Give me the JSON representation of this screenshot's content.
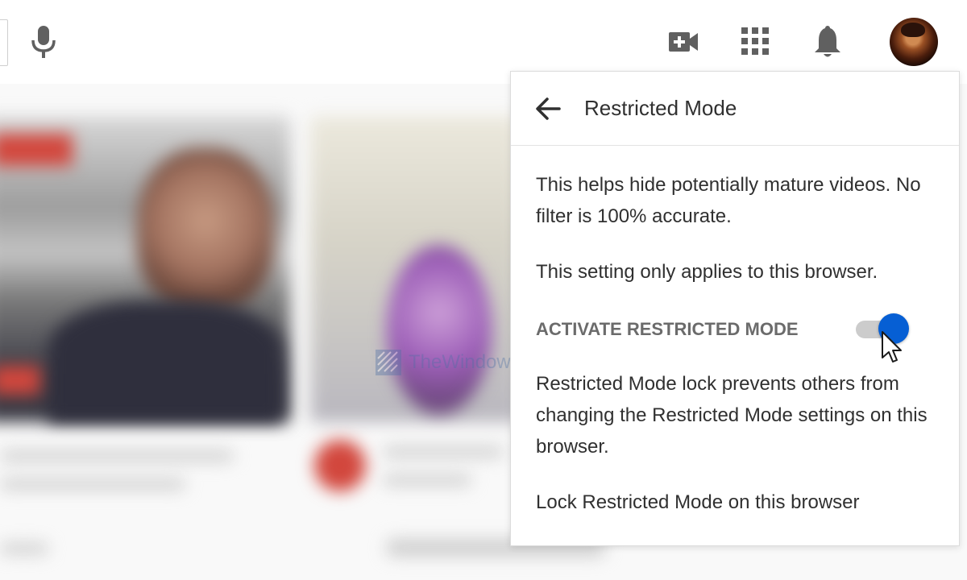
{
  "header": {
    "icons": [
      "mic-icon",
      "video-camera-add-icon",
      "apps-grid-icon",
      "notifications-bell-icon",
      "avatar"
    ]
  },
  "panel": {
    "title": "Restricted Mode",
    "description": "This helps hide potentially mature videos. No filter is 100% accurate.",
    "browser_note": "This setting only applies to this browser.",
    "toggle_label": "ACTIVATE RESTRICTED MODE",
    "toggle_state": true,
    "lock_info": "Restricted Mode lock prevents others from changing the Restricted Mode settings on this browser.",
    "lock_link": "Lock Restricted Mode on this browser"
  },
  "watermark": {
    "text": "TheWindowsClub"
  },
  "colors": {
    "accent": "#065fd4",
    "text": "#303030",
    "label": "#6b6b6b",
    "brand_red": "#d2473d"
  }
}
